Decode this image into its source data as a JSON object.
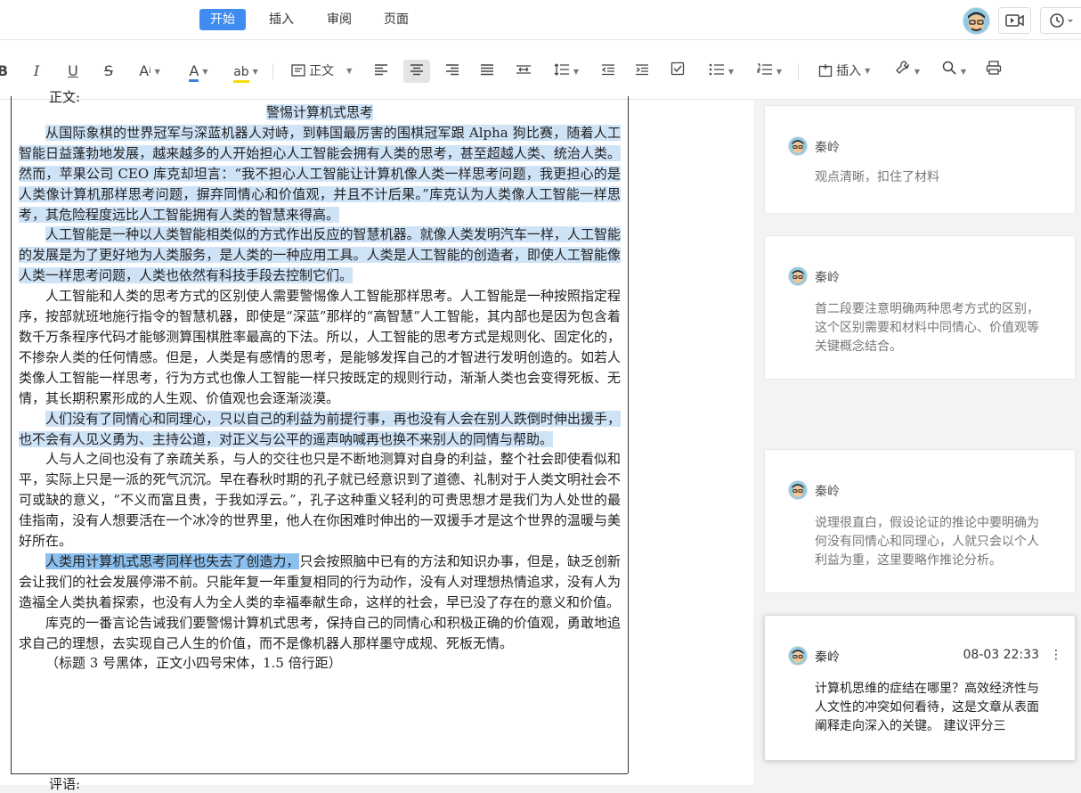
{
  "tabs": [
    {
      "label": "开始",
      "active": true
    },
    {
      "label": "插入",
      "active": false
    },
    {
      "label": "审阅",
      "active": false
    },
    {
      "label": "页面",
      "active": false
    }
  ],
  "toolbar": {
    "bold": "B",
    "italic": "I",
    "underline": "U",
    "strike": "S",
    "font_size": "A",
    "font_color": "A",
    "highlight": "ab",
    "style_label": "正文",
    "insert_label": "插入"
  },
  "document": {
    "cut_top": "正文:",
    "title": "警惕计算机式思考",
    "paragraphs": [
      "从国际象棋的世界冠军与深蓝机器人对峙，到韩国最厉害的围棋冠军跟 Alpha 狗比赛，随着人工智能日益蓬勃地发展，越来越多的人开始担心人工智能会拥有人类的思考，甚至超越人类、统治人类。然而，苹果公司 CEO 库克却坦言：“我不担心人工智能让计算机像人类一样思考问题，我更担心的是人类像计算机那样思考问题，摒弃同情心和价值观，并且不计后果。”库克认为人类像人工智能一样思考，其危险程度远比人工智能拥有人类的智慧来得高。",
      "人工智能是一种以人类智能相类似的方式作出反应的智慧机器。就像人类发明汽车一样，人工智能的发展是为了更好地为人类服务，是人类的一种应用工具。人类是人工智能的创造者，即使人工智能像人类一样思考问题，人类也依然有科技手段去控制它们。",
      "人工智能和人类的思考方式的区别使人需要警惕像人工智能那样思考。人工智能是一种按照指定程序，按部就班地施行指令的智慧机器，即使是“深蓝”那样的“高智慧”人工智能，其内部也是因为包含着数千万条程序代码才能够测算围棋胜率最高的下法。所以，人工智能的思考方式是规则化、固定化的，不掺杂人类的任何情感。但是，人类是有感情的思考，是能够发挥自己的才智进行发明创造的。如若人类像人工智能一样思考，行为方式也像人工智能一样只按既定的规则行动，渐渐人类也会变得死板、无情，其长期积累形成的人生观、价值观也会逐渐淡漠。",
      "人们没有了同情心和同理心，只以自己的利益为前提行事，再也没有人会在别人跌倒时伸出援手，也不会有人见义勇为、主持公道，对正义与公平的遥声呐喊再也换不来别人的同情与帮助。",
      "人与人之间也没有了亲疏关系，与人的交往也只是不断地测算对自身的利益，整个社会即使看似和平，实际上只是一派的死气沉沉。早在春秋时期的孔子就已经意识到了道德、礼制对于人类文明社会不可或缺的意义，“不义而富且贵，于我如浮云。”，孔子这种重义轻利的可贵思想才是我们为人处世的最佳指南，没有人想要活在一个冰冷的世界里，他人在你困难时伸出的一双援手才是这个世界的温暖与美好所在。",
      "只会按照脑中已有的方法和知识办事，但是，缺乏创新会让我们的社会发展停滞不前。只能年复一年重复相同的行为动作，没有人对理想热情追求，没有人为造福全人类执着探索，也没有人为全人类的幸福奉献生命，这样的社会，早已没了存在的意义和价值。",
      "库克的一番言论告诫我们要警惕计算机式思考，保持自己的同情心和积极正确的价值观，勇敢地追求自己的理想，去实现自己人生的价值，而不是像机器人那样墨守成规、死板无情。"
    ],
    "p6_highlight": "人类用计算机式思考同样也失去了创造力，",
    "note": "（标题 3 号黑体，正文小四号宋体，1.5 倍行距）",
    "cut_bottom": "评语:"
  },
  "comments": [
    {
      "author": "秦岭",
      "text": "观点清晰，扣住了材料"
    },
    {
      "author": "秦岭",
      "text": "首二段要注意明确两种思考方式的区别，这个区别需要和材料中同情心、价值观等关键概念结合。"
    },
    {
      "author": "秦岭",
      "text": "说理很直白，假设论证的推论中要明确为何没有同情心和同理心，人就只会以个人利益为重，这里要略作推论分析。"
    },
    {
      "author": "秦岭",
      "time": "08-03 22:33",
      "text": "计算机思维的症结在哪里？高效经济性与人文性的冲突如何看待，这是文章从表面阐释走向深入的关键。 建议评分三"
    }
  ]
}
